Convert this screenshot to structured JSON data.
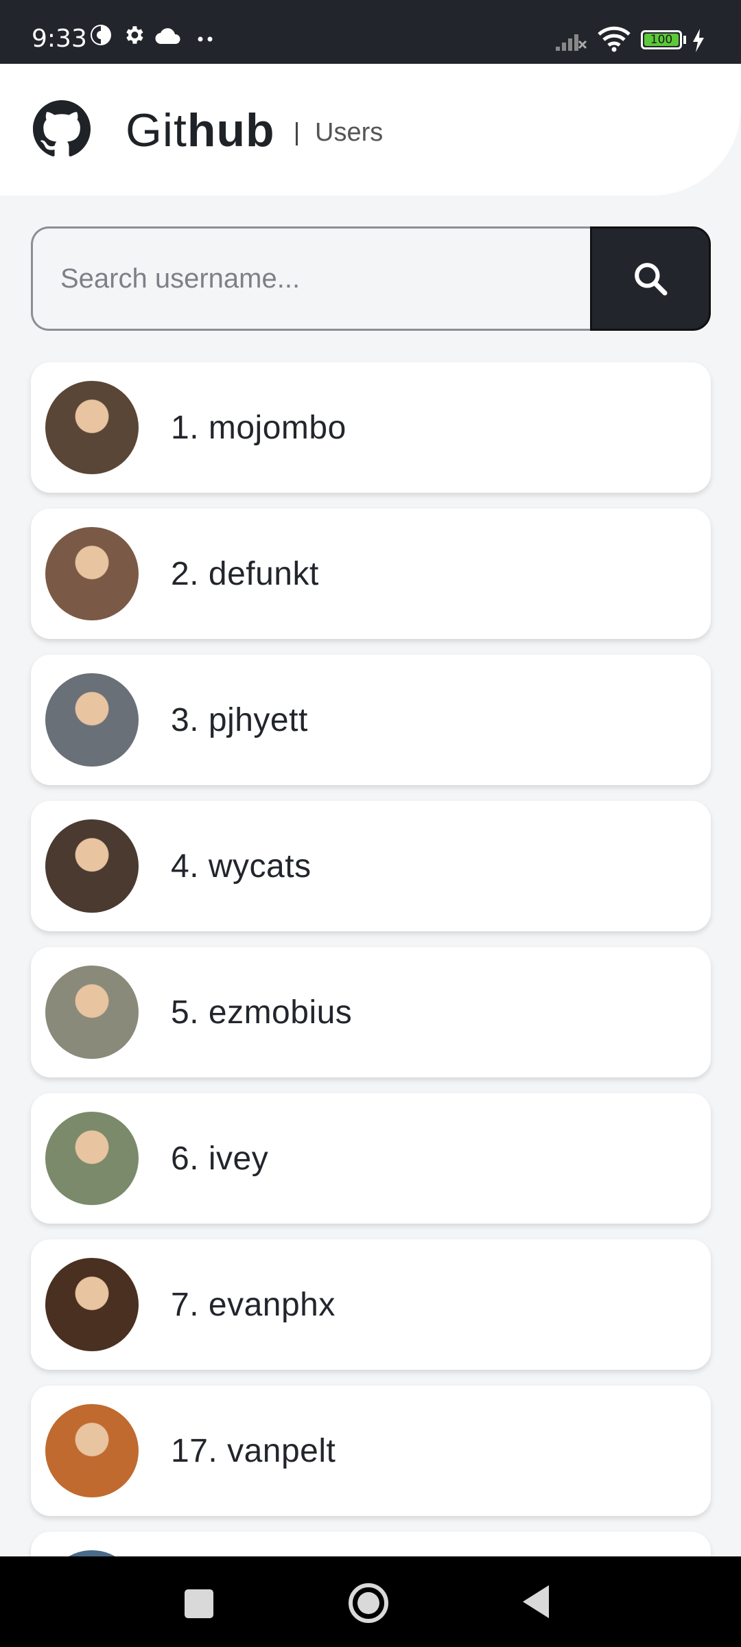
{
  "status_bar": {
    "time": "9:33",
    "battery": "100",
    "icons": [
      "data-saver-icon",
      "settings-gear-icon",
      "cloud-icon",
      "more-dots-icon",
      "signal-off-icon",
      "wifi-icon",
      "battery-icon",
      "charging-bolt-icon"
    ]
  },
  "header": {
    "brand_light": "Git",
    "brand_bold": "hub",
    "subtitle": "Users",
    "logo_icon": "github-octocat-icon"
  },
  "search": {
    "placeholder": "Search username...",
    "value": "",
    "button_icon": "search-icon"
  },
  "users": [
    {
      "label": "1. mojombo",
      "avatar_color": "#5a4636"
    },
    {
      "label": "2. defunkt",
      "avatar_color": "#7a5a46"
    },
    {
      "label": "3. pjhyett",
      "avatar_color": "#6a7078"
    },
    {
      "label": "4. wycats",
      "avatar_color": "#4a3a30"
    },
    {
      "label": "5. ezmobius",
      "avatar_color": "#8a8a7a"
    },
    {
      "label": "6. ivey",
      "avatar_color": "#7a8a6a"
    },
    {
      "label": "7. evanphx",
      "avatar_color": "#4a3020"
    },
    {
      "label": "17. vanpelt",
      "avatar_color": "#c06a30"
    }
  ],
  "colors": {
    "dark": "#22252c",
    "background": "#f4f5f7",
    "card": "#ffffff"
  },
  "nav_bar": {
    "icons": [
      "recents-square-icon",
      "home-circle-icon",
      "back-triangle-icon"
    ]
  }
}
